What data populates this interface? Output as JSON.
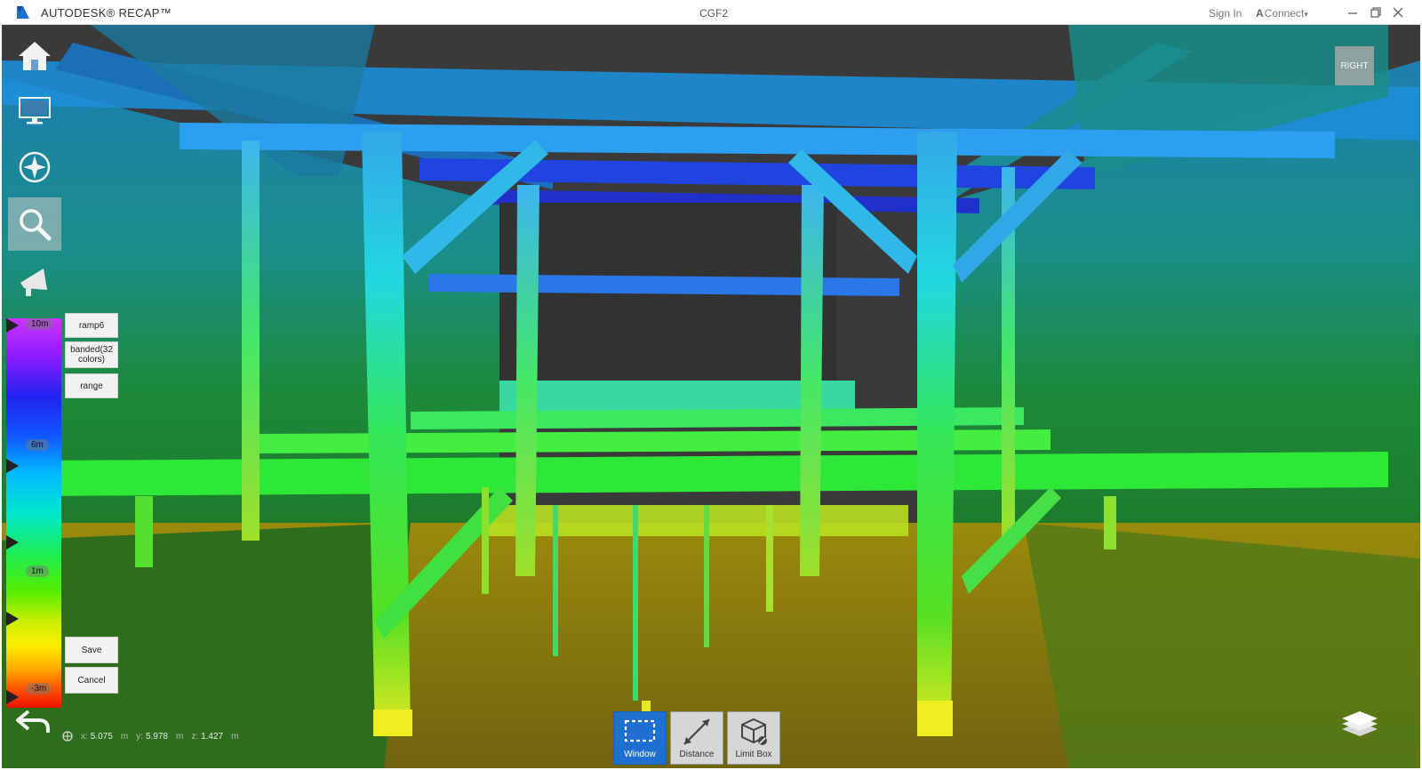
{
  "app": {
    "name": "AUTODESK® RECAP™",
    "document_title": "CGF2",
    "sign_in": "Sign In",
    "connect": "Connect",
    "connect_caret": "▾"
  },
  "window_controls": [
    "minimize-icon",
    "restore-icon",
    "close-icon"
  ],
  "left_tools": [
    {
      "name": "home-icon"
    },
    {
      "name": "monitor-icon"
    },
    {
      "name": "navigate-icon"
    },
    {
      "name": "search-icon"
    },
    {
      "name": "megaphone-icon"
    }
  ],
  "ramp": {
    "ticks": [
      "10m",
      "6m",
      "1m",
      "-3m"
    ],
    "buttons": {
      "ramp6": "ramp6",
      "banded": "banded(32 colors)",
      "range": "range",
      "save": "Save",
      "cancel": "Cancel"
    }
  },
  "bottom_tools": [
    {
      "label": "Window",
      "icon": "window-select-icon",
      "active": true
    },
    {
      "label": "Distance",
      "icon": "distance-icon",
      "active": false
    },
    {
      "label": "Limit Box",
      "icon": "limit-box-icon",
      "active": false
    }
  ],
  "view_cube": {
    "face": "RIGHT"
  },
  "coordinates": {
    "x_label": "x:",
    "x": "5.075",
    "y_label": "y:",
    "y": "5.978",
    "z_label": "z:",
    "z": "1.427",
    "unit": "m"
  },
  "colors": {
    "accent": "#1f6fd1",
    "ceiling": "#3a3a3a",
    "floor": "#8f7d10"
  }
}
